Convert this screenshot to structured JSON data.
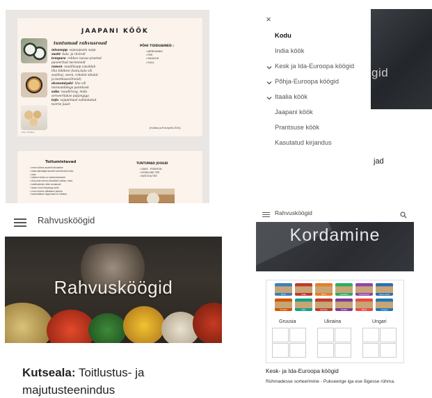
{
  "colors": {
    "accent": "#111111",
    "menu_text": "#555555",
    "hero_dark": "#2a2c31"
  },
  "infographic": {
    "title": "JAAPANI KÖÖK",
    "subtitle": "tuntumad rahvusroad",
    "dishes": [
      {
        "name": "misosupp",
        "desc": "- sojaoapasta supp"
      },
      {
        "name": "sushi",
        "desc": "- kala- ja riisirull"
      },
      {
        "name": "tempura",
        "desc": "- rohkes rasvas praetud"
      },
      {
        "name": "",
        "desc": "paneeritud mereannid"
      },
      {
        "name": "ramen",
        "desc": "- nuudlisupp (sisaldab"
      },
      {
        "name": "",
        "desc": "liha tükikesi (kana,kala või"
      },
      {
        "name": "",
        "desc": "sealiha), seeni, rohelist sibulat"
      },
      {
        "name": "",
        "desc": "ja bambusevõrseid)"
      },
      {
        "name": "okonomiyaki",
        "desc": "- liha või"
      },
      {
        "name": "",
        "desc": "mereandidega pannkook"
      },
      {
        "name": "soba",
        "desc": "- nuudliroog, mida"
      },
      {
        "name": "",
        "desc": "serveeritakse puljongiga"
      },
      {
        "name": "tofu",
        "desc": "- sojapiimast valmistatud"
      },
      {
        "name": "",
        "desc": "toorne juust"
      }
    ],
    "ingredients_title": "PÕHI TOIDUAINED :",
    "ingredients": [
      "MEREANNID",
      "RIIS",
      "NUUDLID",
      "KALA"
    ],
    "source": "(Kotkas ja Rosnydhl,2010).",
    "photo_credit": "Foto: Pixabay",
    "tips_title": "Toitumistavad",
    "tips": [
      "enne sööma asumist tänatakse",
      "toiduvalmistajat kombel seirveeritud toidu",
      "eest",
      "söödud kokku on taotavaremaaid",
      "tühi peab olema võimalikult vaikse, seda",
      "toiddlokkeles mitte arvatavalt",
      "lauas ei tohi kõpseiga sulid",
      "enne sööma vallistatud pealud",
      "kuulutatakse väga kaaa on lubatud"
    ],
    "drinks_title": "TUNTUMAD JOOGID",
    "drinks": [
      "SAKE - RIISIVEIN",
      "ROHELINE TEE",
      "MATCHA TEE"
    ]
  },
  "drawer": {
    "close_glyph": "×",
    "items": [
      {
        "label": "Kodu",
        "active": true,
        "chevron": false
      },
      {
        "label": "India köök",
        "active": false,
        "chevron": false
      },
      {
        "label": "Kesk ja Ida-Euroopa köögid",
        "active": false,
        "chevron": true
      },
      {
        "label": "Põhja-Euroopa köögid",
        "active": false,
        "chevron": true
      },
      {
        "label": "Itaalia köök",
        "active": false,
        "chevron": true
      },
      {
        "label": "Jaapani köök",
        "active": false,
        "chevron": false
      },
      {
        "label": "Prantsuse köök",
        "active": false,
        "chevron": false
      },
      {
        "label": "Kasutatud kirjandus",
        "active": false,
        "chevron": false
      }
    ],
    "bg_hero_text": "gid",
    "bg_body_text": "jad"
  },
  "page_c": {
    "title": "Rahvusköögid",
    "hero_text": "Rahvusköögid",
    "label_bold": "Kutseala:",
    "label_rest": " Toitlustus- ja",
    "line2": "majutusteenindus"
  },
  "page_d": {
    "title": "Rahvusköögid",
    "hero_text": "Kordamine",
    "tiles": [
      {
        "label": "Borš",
        "color": "#3a7fc1"
      },
      {
        "label": "Kalja",
        "color": "#c0392b"
      },
      {
        "label": "Borš",
        "color": "#e67e22"
      },
      {
        "label": "Golubtsõ",
        "color": "#27ae60"
      },
      {
        "label": "Pelmeenid",
        "color": "#8e44ad"
      },
      {
        "label": "Kiievi kotlet",
        "color": "#2c6fb3"
      },
      {
        "label": "Pirukad",
        "color": "#d35400"
      },
      {
        "label": "Salo",
        "color": "#16a085"
      },
      {
        "label": "Halušky",
        "color": "#c0392b"
      },
      {
        "label": "Gulašš",
        "color": "#7d3c98"
      },
      {
        "label": "Blinid",
        "color": "#e74c3c"
      },
      {
        "label": "Langos",
        "color": "#1f77b4"
      }
    ],
    "columns": [
      "Gruusia",
      "Ukraina",
      "Ungari"
    ],
    "caption_title": "Kesk- ja Ida-Euroopa köögid",
    "caption_text": "Rühmadesse sorteerimine - Pukseerige iga ese õigesse rühma."
  }
}
